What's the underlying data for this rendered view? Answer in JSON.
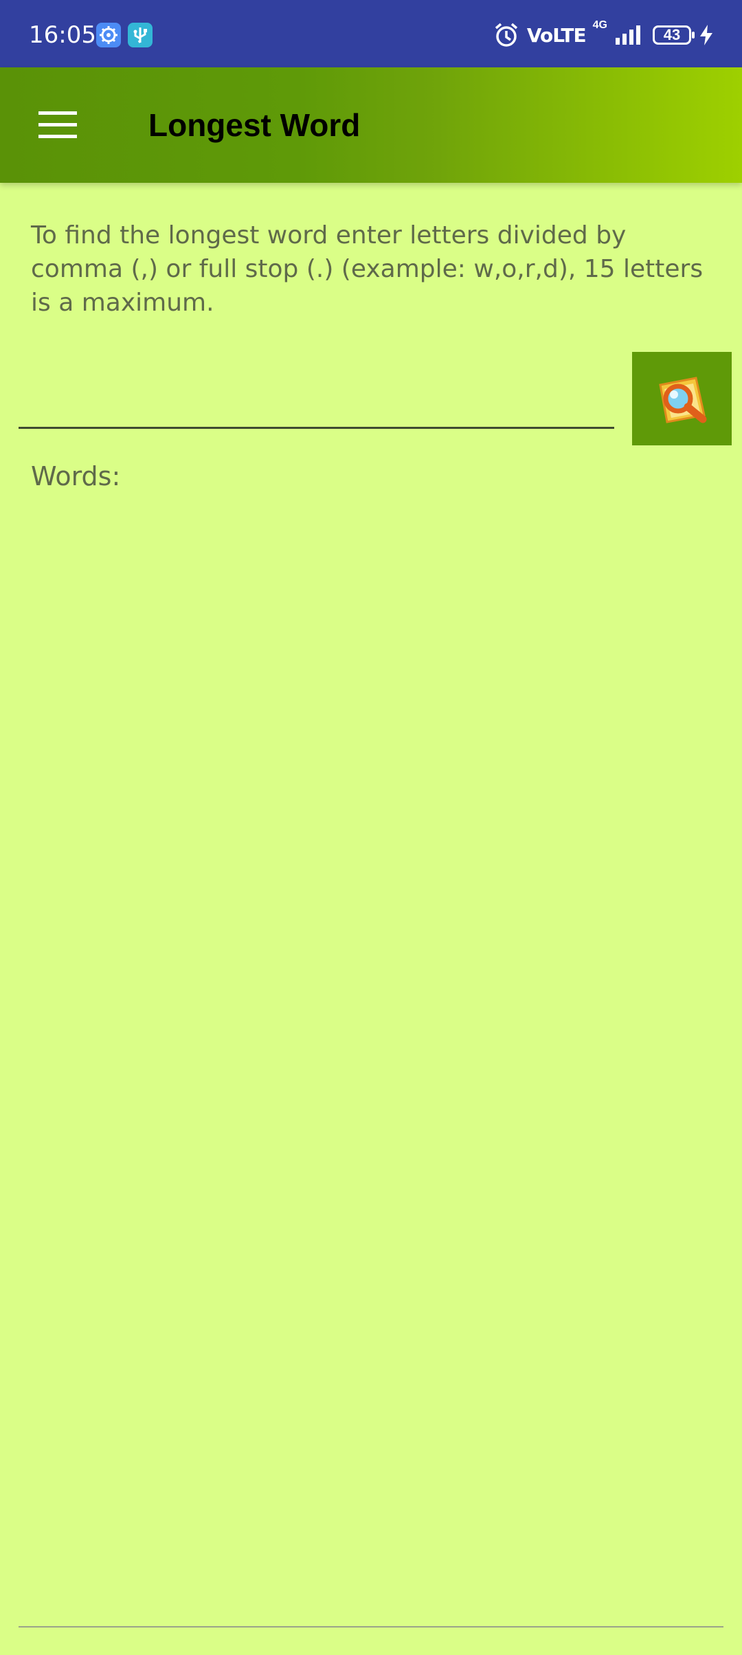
{
  "status_bar": {
    "time": "16:05",
    "network": "VoLTE",
    "network_type": "4G",
    "battery": "43",
    "icons": [
      "settings-notification-icon",
      "usb-notification-icon",
      "alarm-icon",
      "signal-icon",
      "battery-icon",
      "charging-icon"
    ]
  },
  "app_bar": {
    "title": "Longest Word",
    "menu_icon": "hamburger-menu-icon"
  },
  "main": {
    "instructions": "To find the longest word enter letters divided by comma (,) or full stop (.) (example: w,o,r,d), 15 letters is a maximum.",
    "input_value": "",
    "search_button_icon": "magnifier-search-icon",
    "words_label": "Words:"
  },
  "colors": {
    "status_bar": "#32409f",
    "app_bar_start": "#5a9207",
    "app_bar_end": "#9ed000",
    "background": "#dafe87",
    "text": "#5f6a4a",
    "search_button": "#5f9a08"
  }
}
